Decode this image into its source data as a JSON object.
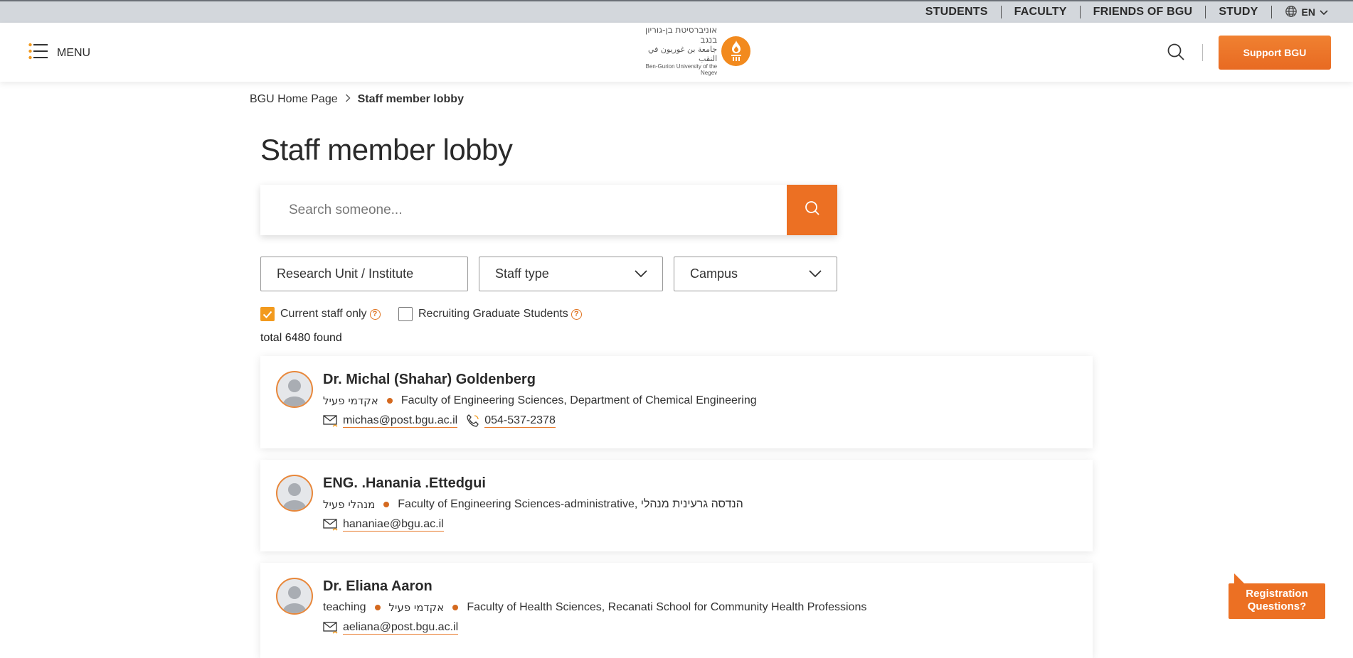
{
  "topbar": {
    "links": [
      "STUDENTS",
      "FACULTY",
      "FRIENDS OF BGU",
      "STUDY"
    ],
    "language": "EN"
  },
  "header": {
    "menu_label": "MENU",
    "logo": {
      "hebrew": "אוניברסיטת בן-גוריון בנגב",
      "arabic": "جامعة بن غوريون في النقب",
      "english": "Ben-Gurion University of the Negev"
    },
    "support_label": "Support BGU"
  },
  "breadcrumb": {
    "home": "BGU Home Page",
    "current": "Staff member lobby"
  },
  "page_title": "Staff member lobby",
  "search": {
    "placeholder": "Search someone...",
    "value": ""
  },
  "filters": {
    "research_unit": "Research Unit / Institute",
    "staff_type": "Staff type",
    "campus": "Campus"
  },
  "checkboxes": {
    "current_staff": {
      "label": "Current staff only",
      "checked": true
    },
    "recruiting": {
      "label": "Recruiting Graduate Students",
      "checked": false
    }
  },
  "total": "total 6480 found",
  "results": [
    {
      "name": "Dr. Michal (Shahar) Goldenberg",
      "tags": [
        "אקדמי פעיל"
      ],
      "faculty": "Faculty of Engineering Sciences, Department of Chemical Engineering",
      "email": "michas@post.bgu.ac.il",
      "phone": "054-537-2378"
    },
    {
      "name": "ENG. .Hanania .Ettedgui",
      "tags": [
        "מנהלי פעיל"
      ],
      "faculty": "Faculty of Engineering Sciences-administrative, הנדסה גרעינית מנהלי",
      "email": "hananiae@bgu.ac.il",
      "phone": ""
    },
    {
      "name": "Dr. Eliana Aaron",
      "tags": [
        "teaching",
        "אקדמי פעיל"
      ],
      "faculty": "Faculty of Health Sciences, Recanati School for Community Health Professions",
      "email": "aeliana@post.bgu.ac.il",
      "phone": ""
    }
  ],
  "registration": "Registration Questions?",
  "colors": {
    "accent": "#ec7023",
    "checkbox": "#f29a1e",
    "topbar": "#d3d7dc"
  }
}
